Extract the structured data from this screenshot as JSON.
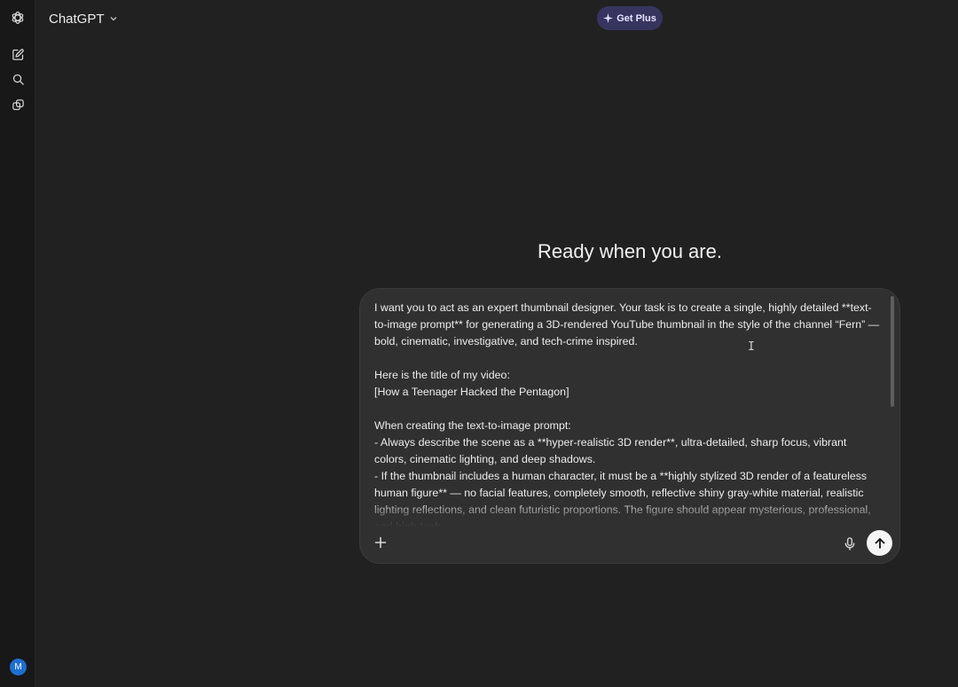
{
  "app": {
    "model_name": "ChatGPT",
    "get_plus_label": "Get Plus",
    "avatar_initial": "M"
  },
  "sidebar": {
    "items": [
      {
        "icon": "new-chat-icon"
      },
      {
        "icon": "search-icon"
      },
      {
        "icon": "library-icon"
      }
    ]
  },
  "main": {
    "heading": "Ready when you are."
  },
  "composer": {
    "text": "I want you to act as an expert thumbnail designer. Your task is to create a single, highly detailed **text-to-image prompt** for generating a 3D-rendered YouTube thumbnail in the style of the channel “Fern” — bold, cinematic, investigative, and tech-crime inspired.\n\nHere is the title of my video:\n[How a Teenager Hacked the Pentagon]\n\nWhen creating the text-to-image prompt:\n- Always describe the scene as a **hyper-realistic 3D render**, ultra-detailed, sharp focus, vibrant colors, cinematic lighting, and deep shadows.\n- If the thumbnail includes a human character, it must be a **highly stylized 3D render of a featureless human figure** — no facial features, completely smooth, reflective shiny gray-white material, realistic lighting reflections, and clean futuristic proportions. The figure should appear mysterious, professional, and high-tech.",
    "cursor_glyph": "I"
  },
  "colors": {
    "background": "#212121",
    "rail": "#181818",
    "composer": "#303030",
    "get_plus_bg": "#373560",
    "avatar": "#1f6fd1",
    "send_button": "#f5f5f5"
  }
}
